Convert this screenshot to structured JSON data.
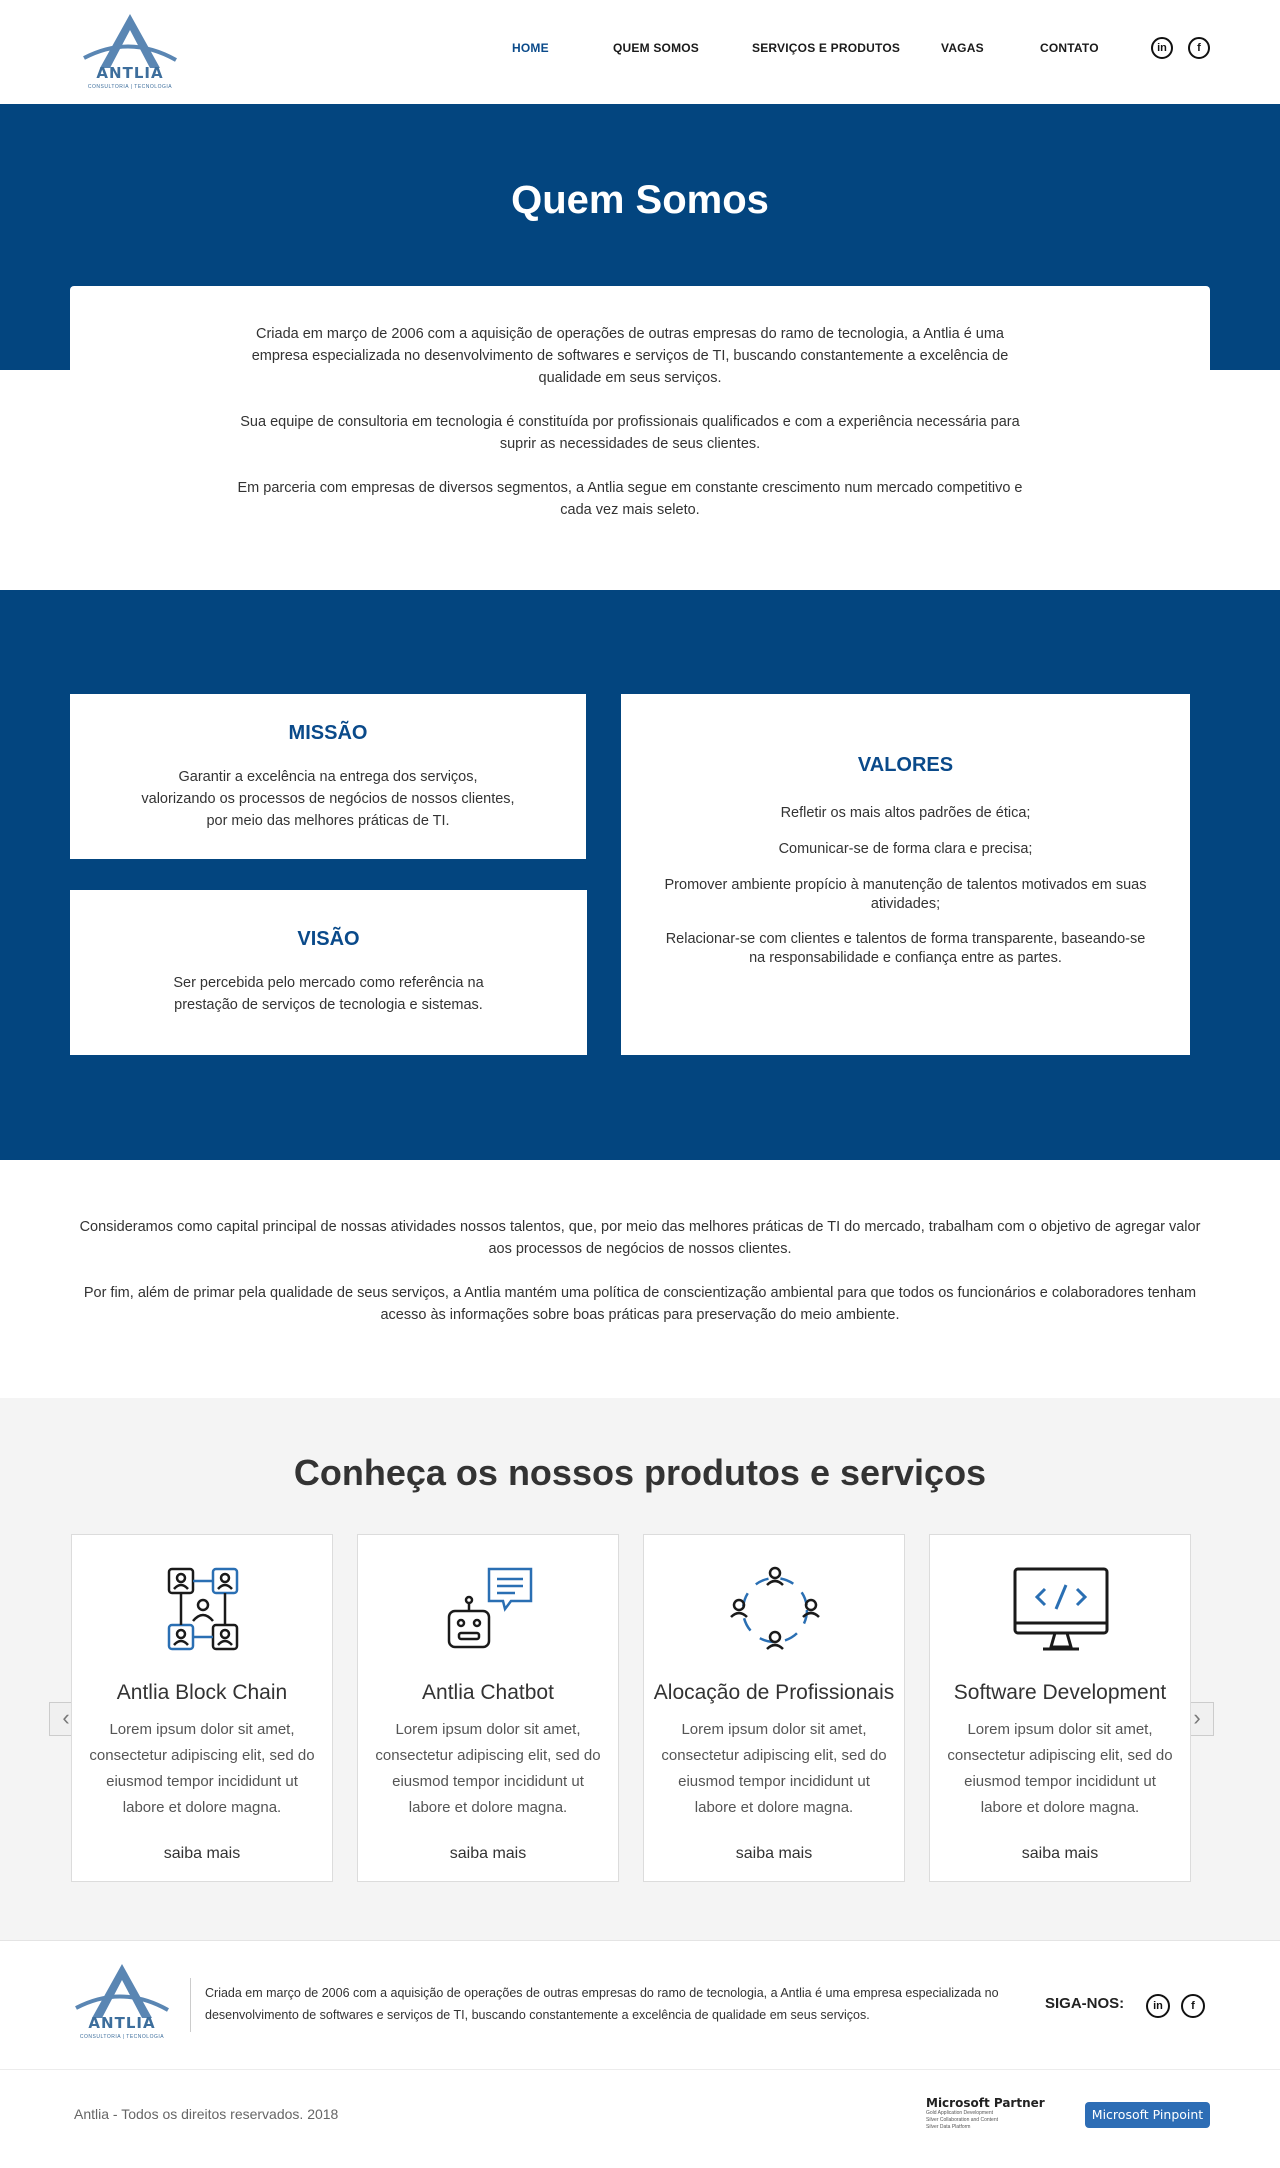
{
  "nav": {
    "items": [
      "HOME",
      "QUEM SOMOS",
      "SERVIÇOS E PRODUTOS",
      "VAGAS",
      "CONTATO"
    ],
    "active_index": 0
  },
  "logo": {
    "name": "ANTLIA",
    "tagline": "CONSULTORIA | TECNOLOGIA"
  },
  "social": {
    "linkedin": "in",
    "facebook": "f"
  },
  "hero": {
    "title": "Quem Somos"
  },
  "intro": {
    "paragraphs": [
      "Criada em março de 2006 com a aquisição de operações de outras empresas do ramo de tecnologia, a Antlia é uma empresa especializada no desenvolvimento de softwares e serviços de TI, buscando constantemente a excelência de qualidade em seus serviços.",
      "Sua equipe de consultoria em tecnologia é constituída por profissionais qualificados e com a experiência necessária para suprir as necessidades de seus clientes.",
      "Em parceria com empresas de diversos segmentos, a Antlia segue em constante crescimento num mercado competitivo e cada vez mais seleto."
    ]
  },
  "missao": {
    "title": "MISSÃO",
    "text": "Garantir a excelência na entrega dos serviços, valorizando os processos de negócios de nossos clientes, por meio das melhores práticas de TI."
  },
  "visao": {
    "title": "VISÃO",
    "text": "Ser percebida pelo mercado como referência na prestação de serviços de tecnologia e sistemas."
  },
  "valores": {
    "title": "VALORES",
    "items": [
      "Refletir os mais altos padrões de ética;",
      "Comunicar-se de forma clara e precisa;",
      "Promover ambiente propício à manutenção de talentos motivados em suas atividades;",
      "Relacionar-se com clientes e talentos de forma transparente, baseando-se na responsabilidade e confiança entre as partes."
    ]
  },
  "closing": {
    "paragraphs": [
      "Consideramos como capital principal de nossas atividades nossos talentos, que, por meio das melhores práticas de TI do mercado, trabalham com o objetivo de agregar valor aos processos de negócios de nossos clientes.",
      "Por fim, além de primar pela qualidade de seus serviços, a Antlia mantém uma política de conscientização ambiental para que todos os funcionários e colaboradores tenham acesso às informações sobre boas práticas para preservação do meio ambiente."
    ]
  },
  "products": {
    "title": "Conheça os nossos produtos e serviços",
    "items": [
      {
        "name": "Antlia Block Chain",
        "icon": "blockchain-icon",
        "desc": "Lorem ipsum dolor sit amet, consectetur adipiscing elit, sed do eiusmod tempor incididunt ut labore et dolore magna.",
        "more": "saiba mais"
      },
      {
        "name": "Antlia Chatbot",
        "icon": "chatbot-icon",
        "desc": "Lorem ipsum dolor sit amet, consectetur adipiscing elit, sed do eiusmod tempor incididunt ut labore et dolore magna.",
        "more": "saiba mais"
      },
      {
        "name": "Alocação de Profissionais",
        "icon": "people-network-icon",
        "desc": "Lorem ipsum dolor sit amet, consectetur adipiscing elit, sed do eiusmod tempor incididunt ut labore et dolore magna.",
        "more": "saiba mais"
      },
      {
        "name": "Software Development",
        "icon": "code-monitor-icon",
        "desc": "Lorem ipsum dolor sit amet, consectetur adipiscing elit, sed do eiusmod tempor incididunt ut labore et dolore magna.",
        "more": "saiba mais"
      }
    ],
    "prev": "‹",
    "next": "›"
  },
  "footer": {
    "text": "Criada em março de 2006 com a aquisição de operações de outras empresas do ramo de tecnologia, a Antlia é uma empresa especializada no desenvolvimento de softwares e serviços de TI, buscando constantemente a excelência de qualidade em seus serviços.",
    "follow": "SIGA-NOS:",
    "copyright": "Antlia - Todos os direitos reservados. 2018",
    "partner_title": "Microsoft Partner",
    "partner_lines": [
      "Gold  Application Development",
      "Silver  Collaboration and Content",
      "Silver  Data Platform"
    ],
    "pinpoint": "Microsoft Pinpoint"
  },
  "colors": {
    "primary": "#03457f",
    "accent_title": "#0a4a8a",
    "products_bg": "#f4f4f4"
  }
}
